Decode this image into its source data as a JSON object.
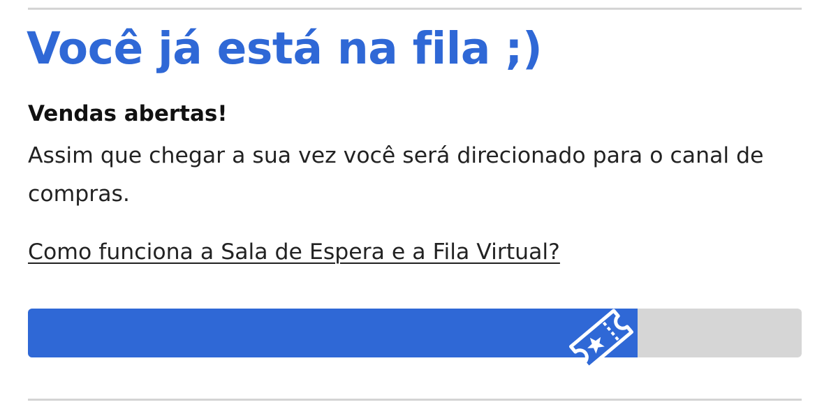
{
  "queue": {
    "title": "Você já está na fila ;)",
    "status": "Vendas abertas!",
    "description": "Assim que chegar a sua vez você será direcionado para o canal de compras.",
    "help_link": "Como funciona a Sala de Espera e a Fila Virtual?",
    "progress_percent": 78.8
  },
  "icons": {
    "progress_marker": "ticket-star-icon"
  },
  "colors": {
    "accent": "#2f68d6",
    "track": "#d6d6d6",
    "divider": "#d4d4d4",
    "text": "#222222"
  }
}
